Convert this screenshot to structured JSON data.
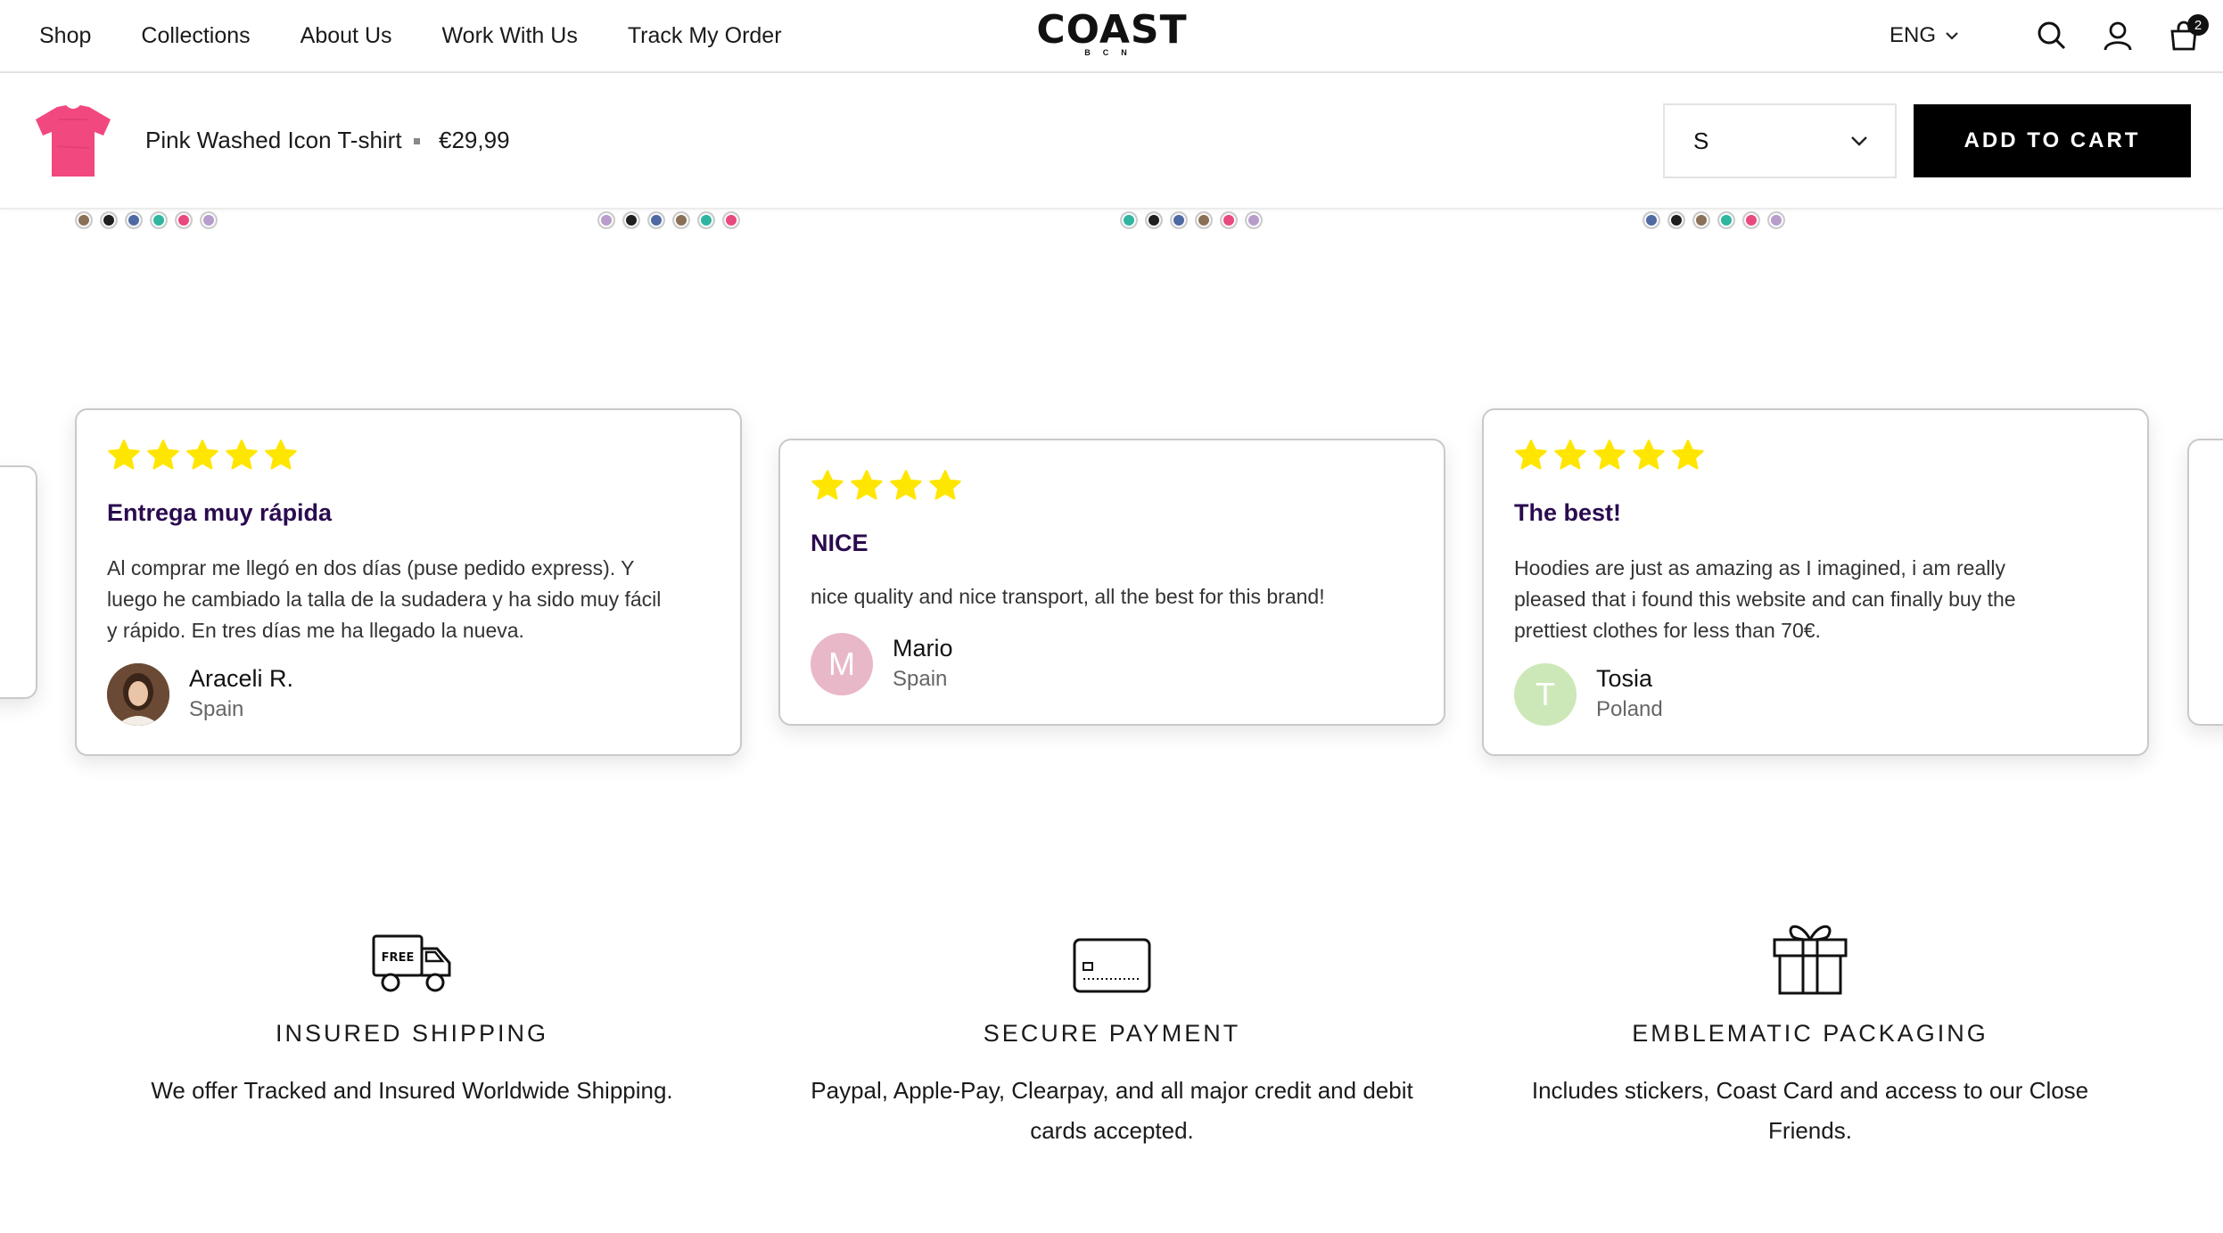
{
  "header": {
    "nav": [
      "Shop",
      "Collections",
      "About Us",
      "Work With Us",
      "Track My Order"
    ],
    "logo_text": "COAST",
    "logo_sub": "BCN",
    "language": "ENG",
    "cart_count": "2",
    "icons": [
      "search-icon",
      "account-icon",
      "cart-icon"
    ]
  },
  "sticky_bar": {
    "product_name": "Pink Washed Icon T-shirt",
    "price": "€29,99",
    "size_value": "S",
    "add_to_cart": "ADD TO CART",
    "thumb_color": "#f0487f"
  },
  "swatch_rows": [
    [
      "#8a7056",
      "#1f1f1f",
      "#4f6aa3",
      "#2fb5a0",
      "#e8497f",
      "#b79ccc"
    ],
    [
      "#b79ccc",
      "#1f1f1f",
      "#4f6aa3",
      "#8a7056",
      "#2fb5a0",
      "#e8497f"
    ],
    [
      "#2fb5a0",
      "#1f1f1f",
      "#4f6aa3",
      "#8a7056",
      "#e8497f",
      "#b79ccc"
    ],
    [
      "#4f6aa3",
      "#1f1f1f",
      "#8a7056",
      "#2fb5a0",
      "#e8497f",
      "#b79ccc"
    ]
  ],
  "reviews": [
    {
      "stars": 5,
      "title": "Entrega muy rápida",
      "body_lines": [
        "Al comprar me llegó en dos días (puse pedido express). Y",
        "luego he cambiado la talla de la sudadera y ha sido muy fácil",
        "y rápido. En tres días me ha llegado la nueva."
      ],
      "name": "Araceli R.",
      "location": "Spain",
      "avatar_letter": "",
      "avatar_color": "#5a3a2a"
    },
    {
      "stars": 4,
      "title": "NICE",
      "body_lines": [
        "nice quality and nice transport, all the best for this brand!"
      ],
      "name": "Mario",
      "location": "Spain",
      "avatar_letter": "M",
      "avatar_color": "#e8b8c8"
    },
    {
      "stars": 5,
      "title": "The best!",
      "body_lines": [
        "Hoodies are just as amazing as I imagined, i am really",
        "pleased that i found this website and can finally buy the",
        "prettiest clothes for less than 70€."
      ],
      "name": "Tosia",
      "location": "Poland",
      "avatar_letter": "T",
      "avatar_color": "#cde8b8"
    }
  ],
  "star_color": "#ffe600",
  "features": [
    {
      "icon": "free-shipping-truck-icon",
      "icon_text": "FREE",
      "title": "INSURED SHIPPING",
      "desc_lines": [
        "We offer Tracked and Insured Worldwide Shipping."
      ]
    },
    {
      "icon": "credit-card-icon",
      "title": "SECURE PAYMENT",
      "desc_lines": [
        "Paypal, Apple-Pay, Clearpay, and all major credit and debit",
        "cards accepted."
      ]
    },
    {
      "icon": "gift-icon",
      "title": "EMBLEMATIC PACKAGING",
      "desc_lines": [
        "Includes stickers, Coast Card and access to our Close Friends."
      ]
    }
  ]
}
